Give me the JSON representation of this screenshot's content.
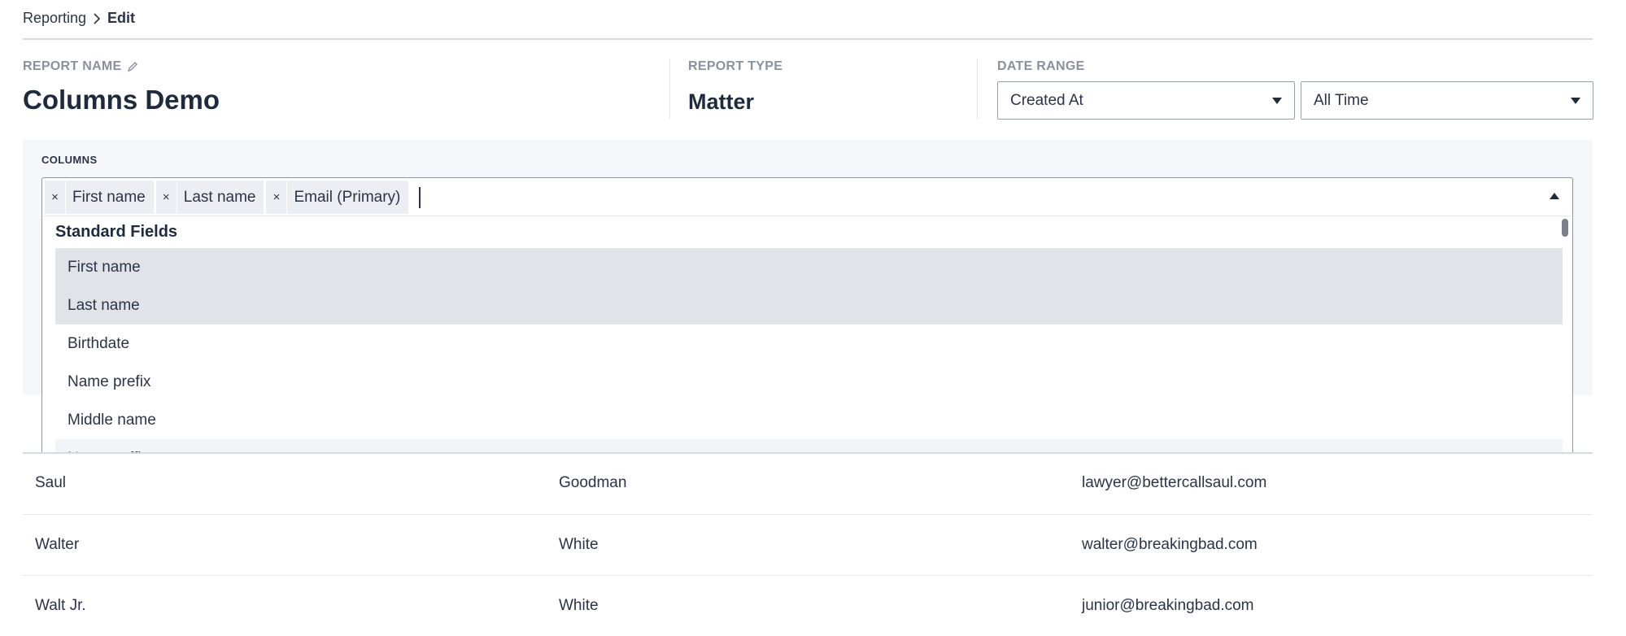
{
  "breadcrumb": {
    "parent": "Reporting",
    "current": "Edit"
  },
  "report_name": {
    "label": "REPORT NAME",
    "value": "Columns Demo"
  },
  "report_type": {
    "label": "REPORT TYPE",
    "value": "Matter"
  },
  "date_range": {
    "label": "DATE RANGE",
    "field_select": "Created At",
    "range_select": "All Time"
  },
  "columns": {
    "label": "COLUMNS",
    "tags": [
      "First name",
      "Last name",
      "Email (Primary)"
    ],
    "remove_glyph": "×",
    "dropdown": {
      "group_label": "Standard Fields",
      "options": [
        {
          "label": "First name",
          "selected": true
        },
        {
          "label": "Last name",
          "selected": true
        },
        {
          "label": "Birthdate",
          "selected": false
        },
        {
          "label": "Name prefix",
          "selected": false
        },
        {
          "label": "Middle name",
          "selected": false
        },
        {
          "label": "Name suffix",
          "selected": false
        }
      ]
    }
  },
  "table": {
    "rows": [
      [
        "Saul",
        "Goodman",
        "lawyer@bettercallsaul.com"
      ],
      [
        "Walter",
        "White",
        "walter@breakingbad.com"
      ],
      [
        "Walt Jr.",
        "White",
        "junior@breakingbad.com"
      ]
    ]
  },
  "icons": {
    "breadcrumb_separator": "chevron-right-icon",
    "edit_name": "pencil-icon",
    "select_caret": "caret-down-icon",
    "multiselect_caret": "caret-up-icon",
    "tag_remove": "close-icon"
  },
  "colors": {
    "text": "#1f2a3c",
    "muted_label": "#8a909c",
    "panel_bg": "#f5f6fa",
    "selected_option_bg": "#e1e3e9"
  }
}
